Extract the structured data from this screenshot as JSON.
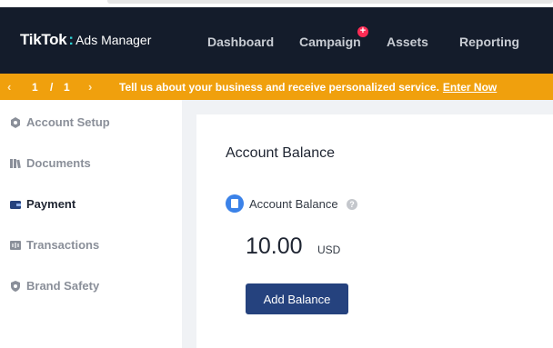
{
  "header": {
    "logo_main": "TikTok",
    "logo_colon": ":",
    "logo_sub": "Ads Manager",
    "nav": {
      "dashboard": "Dashboard",
      "campaign": "Campaign",
      "campaign_badge": "+",
      "assets": "Assets",
      "reporting": "Reporting"
    }
  },
  "notice": {
    "prev": "‹",
    "current_page": "1",
    "separator": "/",
    "total_pages": "1",
    "next": "›",
    "text": "Tell us about your business and receive personalized service.",
    "link": "Enter Now"
  },
  "sidebar": {
    "items": [
      {
        "label": "Account Setup",
        "icon": "account-setup-icon"
      },
      {
        "label": "Documents",
        "icon": "documents-icon"
      },
      {
        "label": "Payment",
        "icon": "wallet-icon",
        "active": true
      },
      {
        "label": "Transactions",
        "icon": "transactions-icon"
      },
      {
        "label": "Brand Safety",
        "icon": "shield-icon"
      }
    ]
  },
  "main": {
    "card_title": "Account Balance",
    "balance_label": "Account Balance",
    "help": "?",
    "amount": "10.00",
    "currency": "USD",
    "add_button": "Add Balance"
  },
  "colors": {
    "header_bg": "#141c2b",
    "notice_bg": "#f0a00d",
    "primary_button": "#25427e",
    "accent_cyan": "#2ed3d6",
    "badge_red": "#fe2c55"
  }
}
